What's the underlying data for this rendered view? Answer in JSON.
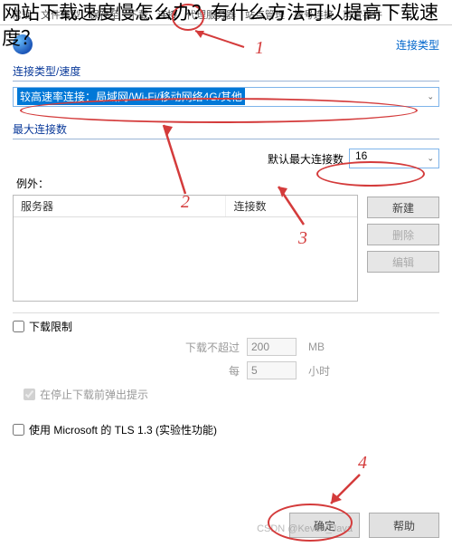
{
  "overlay_title": "网站下载速度慢怎么办？有什么方法可以提高下载速度？",
  "tabs": [
    "常规",
    "文件类型",
    "保存至",
    "下载",
    "连接",
    "代理服务器",
    "站点管理",
    "拨号连接",
    "声音事件"
  ],
  "active_tab_index": 4,
  "header": {
    "conn_type_link": "连接类型"
  },
  "section1": {
    "label": "连接类型/速度",
    "dropdown_value": "较高速率连接：局域网/Wi-Fi/移动网络4G/其他"
  },
  "section2": {
    "label": "最大连接数",
    "default_max_label": "默认最大连接数",
    "default_max_value": "16",
    "except_label": "例外：",
    "table_headers": {
      "server": "服务器",
      "conn": "连接数"
    },
    "buttons": {
      "new": "新建",
      "delete": "删除",
      "edit": "编辑"
    }
  },
  "limit": {
    "chk_label": "下载限制",
    "row1_label": "下载不超过",
    "row1_value": "200",
    "row1_unit": "MB",
    "row2_label": "每",
    "row2_value": "5",
    "row2_unit": "小时",
    "stop_popup": "在停止下载前弹出提示"
  },
  "tls": {
    "label": "使用 Microsoft 的 TLS 1.3 (实验性功能)"
  },
  "footer": {
    "ok": "确定",
    "help": "帮助"
  },
  "annotations": {
    "n1": "1",
    "n2": "2",
    "n3": "3",
    "n4": "4"
  },
  "watermark": "CSDN @Keven_Java"
}
